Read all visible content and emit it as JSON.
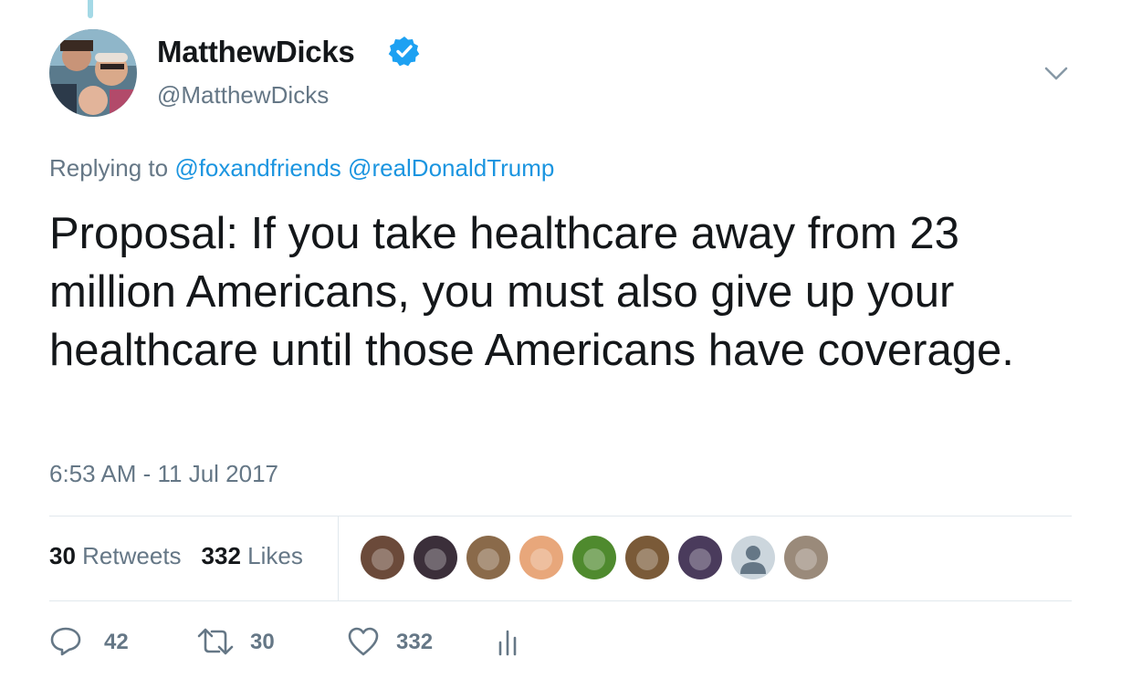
{
  "author": {
    "display_name": "MatthewDicks",
    "handle": "@MatthewDicks",
    "verified_icon": "verified-badge-icon"
  },
  "reply": {
    "prefix": "Replying to",
    "mentions": [
      "@foxandfriends",
      "@realDonaldTrump"
    ]
  },
  "tweet": {
    "text": "Proposal: If you take healthcare away from 23 million Americans, you must also give up your healthcare until those Americans have coverage.",
    "timestamp": "6:53 AM - 11 Jul 2017"
  },
  "stats": {
    "retweets_count": "30",
    "retweets_label": "Retweets",
    "likes_count": "332",
    "likes_label": "Likes"
  },
  "likers": [
    {
      "icon": "liker-avatar-dog",
      "color": "#6b4a3a"
    },
    {
      "icon": "liker-avatar-dogs",
      "color": "#3b2f3a"
    },
    {
      "icon": "liker-avatar-woman",
      "color": "#8a6a4a"
    },
    {
      "icon": "liker-avatar-redhead",
      "color": "#e8a77b"
    },
    {
      "icon": "liker-avatar-green-monster",
      "color": "#4f8a2e"
    },
    {
      "icon": "liker-avatar-group",
      "color": "#7a5a38"
    },
    {
      "icon": "liker-avatar-purple-hair",
      "color": "#4a3b5c"
    },
    {
      "icon": "liker-avatar-default",
      "color": "#ccd6dd"
    },
    {
      "icon": "liker-avatar-animal",
      "color": "#9a8a7a"
    }
  ],
  "actions": {
    "reply": {
      "icon": "reply-icon",
      "count": "42"
    },
    "retweet": {
      "icon": "retweet-icon",
      "count": "30"
    },
    "like": {
      "icon": "heart-icon",
      "count": "332"
    },
    "analytics": {
      "icon": "analytics-icon"
    }
  },
  "colors": {
    "link": "#1b95e0",
    "secondary": "#657786",
    "primary": "#14171a",
    "divider": "#e1e8ed",
    "verified": "#1da1f2"
  }
}
